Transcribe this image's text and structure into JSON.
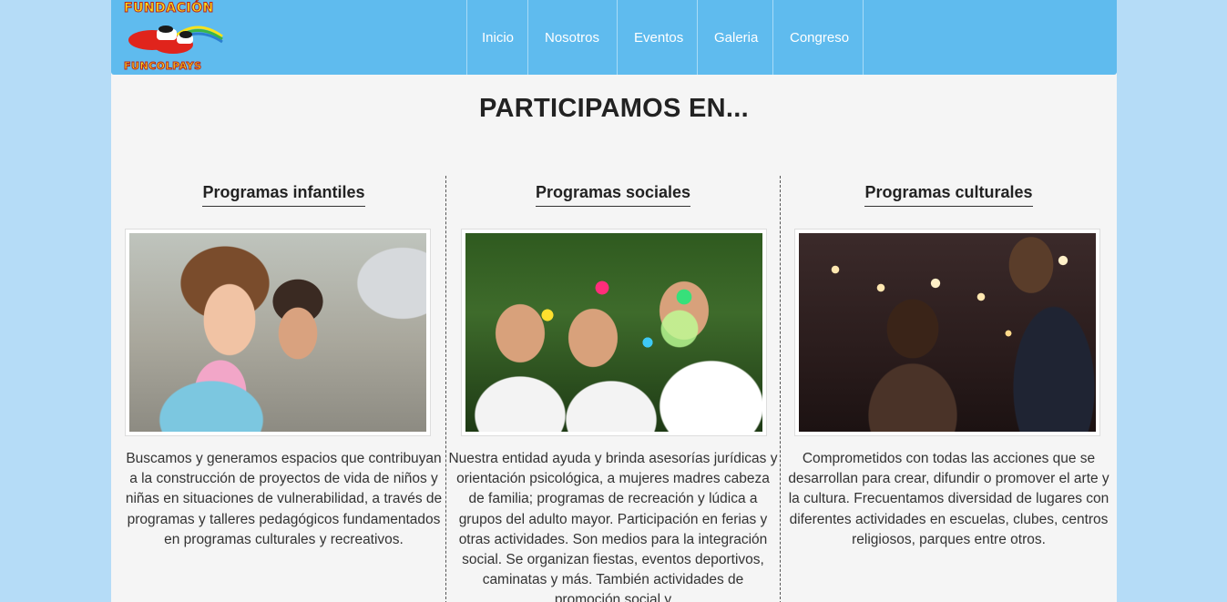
{
  "brand": {
    "logo_top": "FUNDACIÓN",
    "logo_bottom": "FUNCOLPAYS"
  },
  "nav": {
    "items": [
      {
        "label": "Inicio"
      },
      {
        "label": "Nosotros"
      },
      {
        "label": "Eventos"
      },
      {
        "label": "Galeria"
      },
      {
        "label": "Congreso"
      }
    ]
  },
  "section": {
    "title": "PARTICIPAMOS EN..."
  },
  "columns": [
    {
      "title": "Programas infantiles",
      "text": "Buscamos y generamos espacios que contribuyan a la construcción de proyectos de vida de niños y niñas en situaciones de vulnerabilidad, a través de programas y talleres pedagógicos fundamentados en programas culturales y recreativos."
    },
    {
      "title": "Programas sociales",
      "text": "Nuestra entidad ayuda y brinda asesorías jurídicas y orientación psicológica, a mujeres madres cabeza de familia; programas de recreación y lúdica a grupos del adulto mayor. Participación en ferias y otras actividades. Son medios para la integración social. Se organizan fiestas, eventos deportivos, caminatas y más. También actividades de promoción social y"
    },
    {
      "title": "Programas culturales",
      "text": "Comprometidos con todas las acciones que se desarrollan para crear, difundir o promover el arte y la cultura. Frecuentamos diversidad de lugares con diferentes actividades en escuelas, clubes, centros religiosos, parques entre otros."
    }
  ],
  "colors": {
    "navbar": "#5fbbee",
    "page_bg": "#b5dcf7",
    "content_bg": "#f5f5f5"
  }
}
